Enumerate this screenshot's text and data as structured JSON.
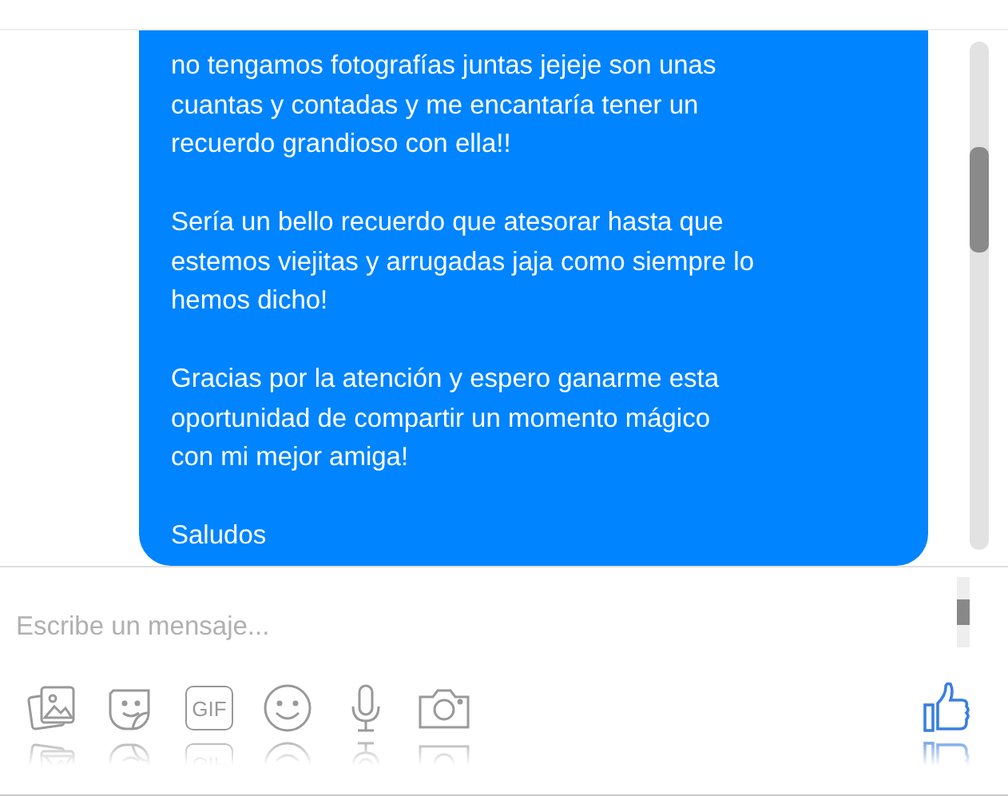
{
  "message": {
    "paragraphs": [
      [
        "no tengamos fotografías juntas jejeje son unas",
        "cuantas y contadas y me encantaría tener un",
        "recuerdo grandioso con ella!!"
      ],
      [
        "Sería un bello recuerdo que atesorar hasta que",
        "estemos viejitas y arrugadas jaja como siempre lo",
        "hemos dicho!"
      ],
      [
        "Gracias por la atención y espero ganarme esta",
        "oportunidad de compartir un momento mágico",
        "con mi mejor amiga!"
      ],
      [
        "Saludos"
      ]
    ]
  },
  "composer": {
    "placeholder": "Escribe un mensaje...",
    "tools": [
      {
        "kind": "photos"
      },
      {
        "kind": "sticker"
      },
      {
        "kind": "gif",
        "label": "GIF"
      },
      {
        "kind": "emoji"
      },
      {
        "kind": "mic"
      },
      {
        "kind": "camera"
      }
    ]
  }
}
